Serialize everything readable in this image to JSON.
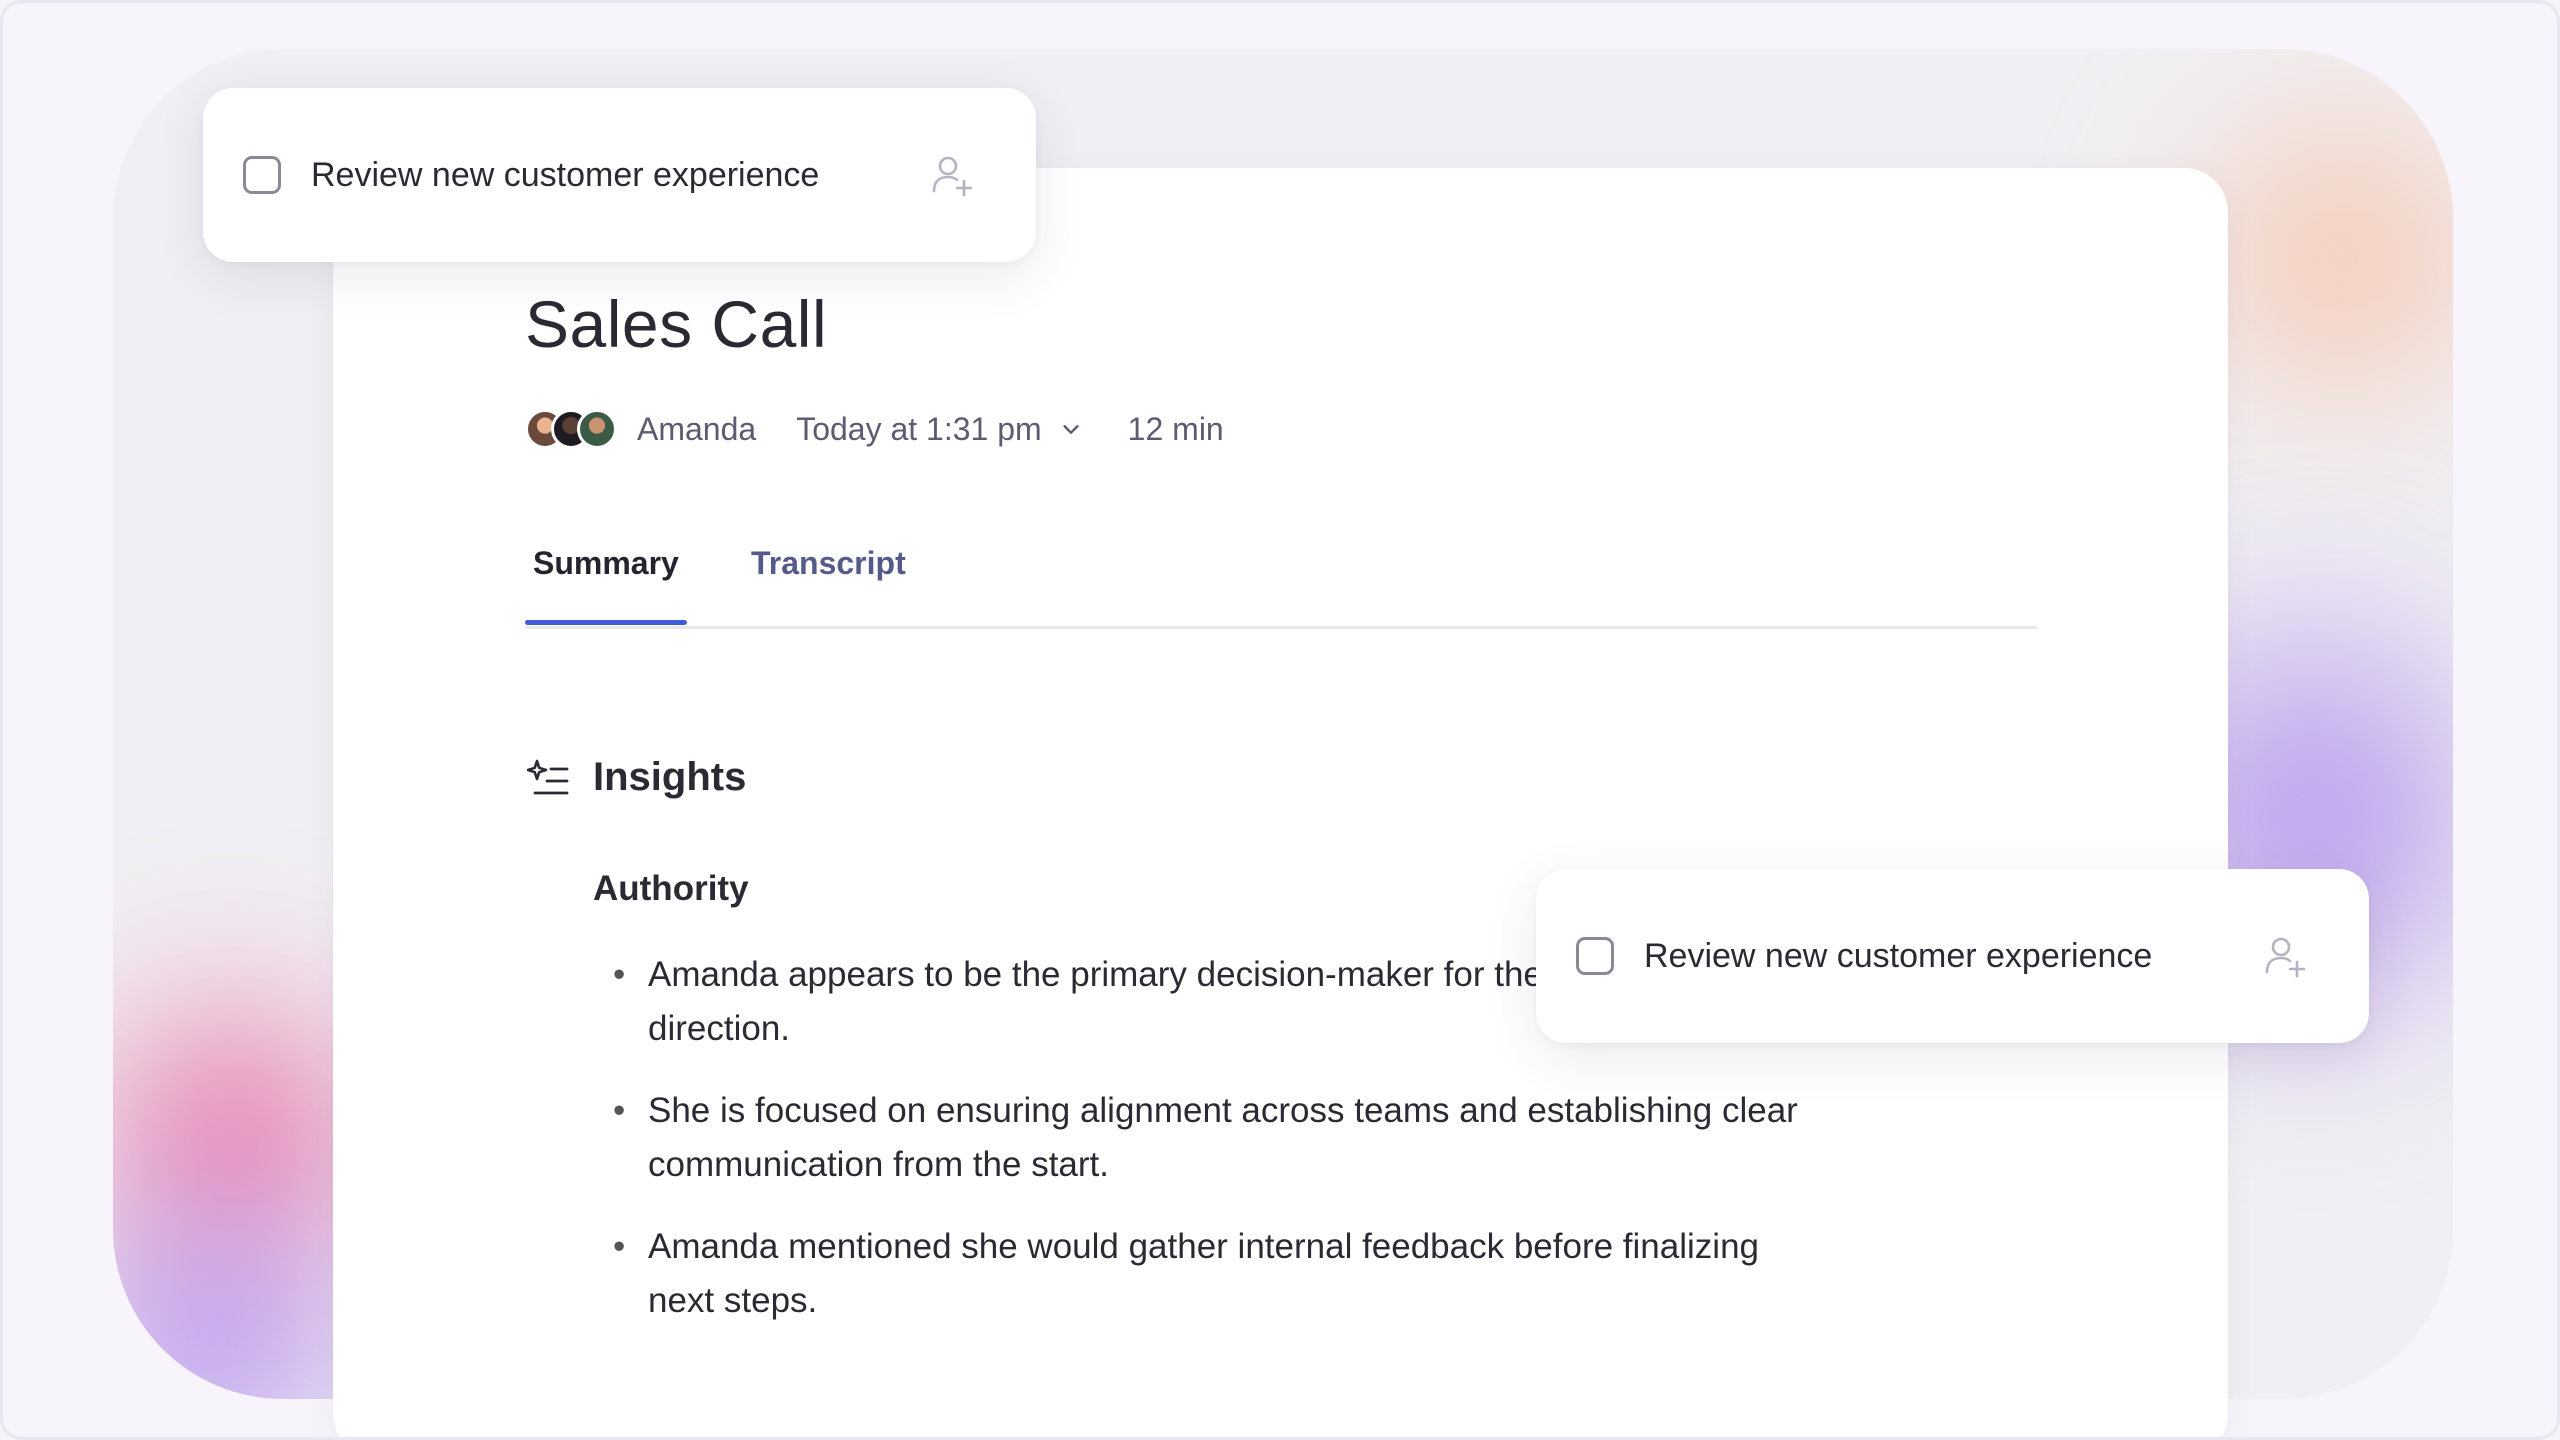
{
  "meeting": {
    "title": "Sales Call",
    "host": "Amanda",
    "date_time": "Today at 1:31 pm",
    "duration": "12 min"
  },
  "tabs": [
    {
      "label": "Summary",
      "active": true
    },
    {
      "label": "Transcript",
      "active": false
    }
  ],
  "insights": {
    "title": "Insights",
    "icon": "sparkle-list-icon",
    "section_title": "Authority",
    "bullets": [
      "Amanda appears to be the primary decision-maker for the project's direction.",
      "She is focused on ensuring alignment across teams and establishing clear communication from the start.",
      "Amanda mentioned she would gather internal feedback before finalizing next steps."
    ]
  },
  "tasks": [
    {
      "label": "Review new customer experience",
      "checked": false,
      "icon": "assign-user-icon"
    },
    {
      "label": "Review new customer experience",
      "checked": false,
      "icon": "assign-user-icon"
    }
  ],
  "colors": {
    "accent": "#3f5bd8",
    "tab_inactive": "#565a8a",
    "meta_text": "#5b5b72"
  }
}
